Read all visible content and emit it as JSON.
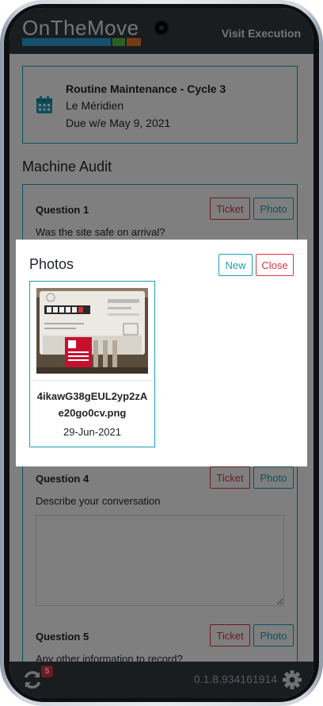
{
  "app": {
    "brand": "OnTheMove",
    "page_title": "Visit Execution",
    "brand_colors": [
      "#2a9fd6",
      "#57c04a",
      "#e8772e"
    ]
  },
  "visit": {
    "name": "Routine Maintenance - Cycle 3",
    "site": "Le Méridien",
    "due": "Due w/e May 9, 2021",
    "icon": "calendar-icon"
  },
  "audit": {
    "title": "Machine Audit",
    "questions": [
      {
        "label": "Question 1",
        "text": "Was the site safe on arrival?",
        "ticket_label": "Ticket",
        "photo_label": "Photo"
      },
      {
        "label": "Question 4",
        "text": "Describe your conversation",
        "ticket_label": "Ticket",
        "photo_label": "Photo",
        "answer": ""
      },
      {
        "label": "Question 5",
        "text": "Any other information to record?",
        "ticket_label": "Ticket",
        "photo_label": "Photo"
      }
    ]
  },
  "photos_modal": {
    "title": "Photos",
    "new_label": "New",
    "close_label": "Close",
    "items": [
      {
        "filename": "4ikawG38gEUL2yp2zAe20go0cv.png",
        "date": "29-Jun-2021"
      }
    ]
  },
  "footer": {
    "sync_count": "5",
    "version": "0.1.8.934161914",
    "sync_icon": "sync-icon",
    "settings_icon": "gear-icon"
  },
  "colors": {
    "accent": "#17a2b8",
    "danger": "#dc3545",
    "bar": "#343a40"
  }
}
